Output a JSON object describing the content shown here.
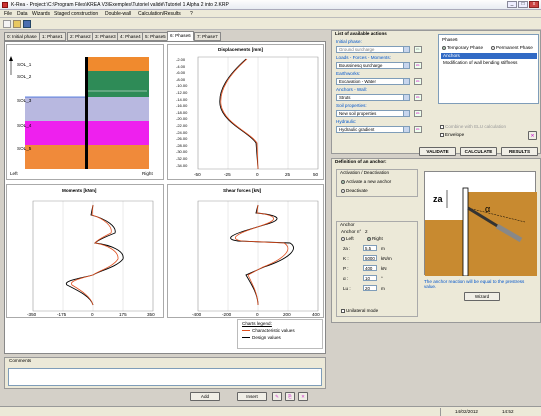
{
  "window": {
    "title": "K-Rea - Project:\\C:\\Program Files\\KREA V3\\Exemples\\Tutoriel validé\\Tutoriel 1 Alpha 2 into 2.KRP",
    "min": "_",
    "max": "□",
    "close": "x"
  },
  "menu": [
    "File",
    "Data",
    "Wizards",
    "Staged construction",
    "Double-wall",
    "Calculation/Results",
    "?"
  ],
  "tabs": [
    "0: Initial phase",
    "1: Phase1",
    "2: Phase2",
    "3: Phase3",
    "4: Phase4",
    "5: Phase5",
    "6: Phase6",
    "7: Phase7"
  ],
  "active_tab": 6,
  "section_chart": {
    "layers": [
      "SOL_1",
      "SOL_2",
      "SOL_3",
      "SOL_4",
      "SOL_5"
    ],
    "left_label": "Left",
    "right_label": "Right"
  },
  "displacements": {
    "title": "Displacements [mm]",
    "yticks": [
      "-2.00",
      "-4.00",
      "-6.00",
      "-8.00",
      "-10.00",
      "-12.00",
      "-14.00",
      "-16.00",
      "-18.00",
      "-20.00",
      "-22.00",
      "-24.00",
      "-26.00",
      "-28.00",
      "-30.00",
      "-32.00",
      "-34.00"
    ],
    "xticks": [
      "-50",
      "-25",
      "0",
      "25",
      "50"
    ]
  },
  "moments": {
    "title": "Moments [kNm]",
    "xticks": [
      "-350",
      "-175",
      "0",
      "175",
      "350"
    ]
  },
  "shear": {
    "title": "Shear forces [kN]",
    "xticks": [
      "-400",
      "-200",
      "0",
      "200",
      "400"
    ]
  },
  "legend": {
    "title": "Charts legend:",
    "char": "Characteristic values",
    "design": "Design values"
  },
  "comments_label": "Comments",
  "bottom_buttons": {
    "add": "Add",
    "insert": "Insert"
  },
  "actions": {
    "title": "List of available actions",
    "initial_phase": {
      "label": "Initial phase:",
      "value": "Ground surcharge"
    },
    "loads": {
      "label": "Loads - Forces - Moments:",
      "value": "Boussinesq surcharge"
    },
    "earthworks": {
      "label": "Earthworks:",
      "value": "Excavation - Water"
    },
    "anchors": {
      "label": "Anchors - Wall:",
      "value": "Struts"
    },
    "soil": {
      "label": "Soil properties:",
      "value": "New soil properties"
    },
    "hydraulic": {
      "label": "Hydraulic:",
      "value": "Hydraulic gradient"
    }
  },
  "phase": {
    "name": "Phase6",
    "temporary": "Temporary Phase",
    "permanent": "Permanent Phase",
    "items": [
      "Anchors",
      "Modification of wall bending stiffness"
    ],
    "combine": "Combine with ELU calculation",
    "envelope": "Envelope"
  },
  "action_buttons": {
    "validate": "VALIDATE",
    "calculate": "CALCULATE",
    "results": "RESULTS"
  },
  "anchor": {
    "title": "Definition of an anchor:",
    "activation": "Activation / Deactivation",
    "activate": "Activate a new anchor",
    "deactivate": "Deactivate",
    "group": "Anchor",
    "anchor_no_label": "Anchor n°",
    "anchor_no": "2",
    "left": "Left",
    "right": "Right",
    "fields": [
      {
        "label": "za :",
        "value": "5.5",
        "unit": "m"
      },
      {
        "label": "K :",
        "value": "5000",
        "unit": "kN/m"
      },
      {
        "label": "P :",
        "value": "400",
        "unit": "kN"
      },
      {
        "label": "α :",
        "value": "10",
        "unit": "°"
      },
      {
        "label": "Lu :",
        "value": "20",
        "unit": "m"
      }
    ],
    "unilateral": "Unilateral mode",
    "note": "The anchor reaction will be equal to the prestress value.",
    "wizard": "Wizard",
    "diagram_za": "za",
    "diagram_alpha": "α"
  },
  "statusbar": {
    "date": "14/02/2012",
    "time": "14:52"
  }
}
